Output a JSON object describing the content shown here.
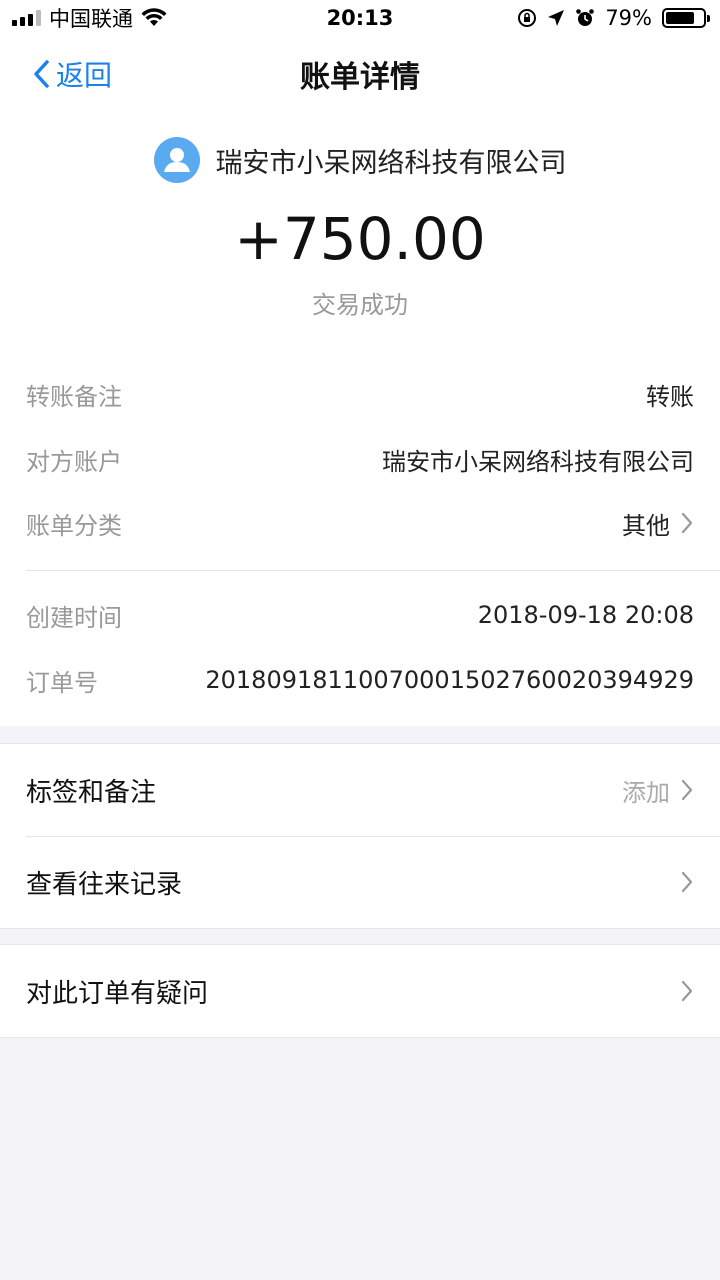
{
  "status_bar": {
    "carrier": "中国联通",
    "time": "20:13",
    "battery_percent": "79%",
    "battery_level": 0.79,
    "icons": [
      "signal-icon",
      "wifi-icon",
      "rotation-lock-icon",
      "location-icon",
      "alarm-icon",
      "battery-icon"
    ]
  },
  "nav": {
    "back_label": "返回",
    "title": "账单详情"
  },
  "summary": {
    "payee_name": "瑞安市小呆网络科技有限公司",
    "amount": "+750.00",
    "status": "交易成功",
    "avatar_color": "#5aaaf0"
  },
  "details": {
    "rows": [
      {
        "label": "转账备注",
        "value": "转账"
      },
      {
        "label": "对方账户",
        "value": "瑞安市小呆网络科技有限公司"
      },
      {
        "label": "账单分类",
        "value": "其他"
      },
      {
        "label": "创建时间",
        "value": "2018-09-18 20:08"
      },
      {
        "label": "订单号",
        "value": "20180918110070001502760020394929"
      }
    ]
  },
  "actions": {
    "tags_label": "标签和备注",
    "tags_hint": "添加",
    "history_label": "查看往来记录",
    "question_label": "对此订单有疑问"
  },
  "colors": {
    "accent": "#1a82e8",
    "background": "#f4f4f8",
    "muted_text": "#999999"
  }
}
